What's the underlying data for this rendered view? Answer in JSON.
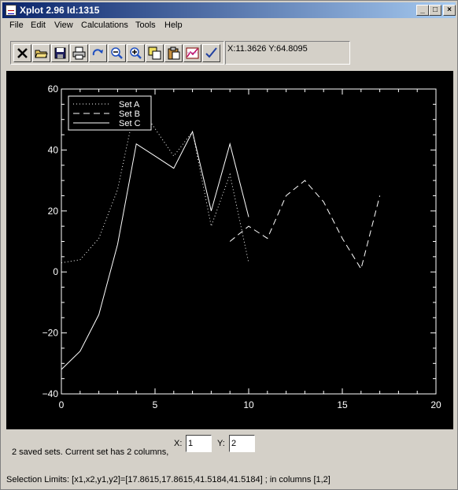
{
  "window": {
    "title": "Xplot 2.96 Id:1315",
    "min_symbol": "_",
    "max_symbol": "□",
    "close_symbol": "×"
  },
  "menu": [
    "File",
    "Edit",
    "View",
    "Calculations",
    "Tools",
    "Help"
  ],
  "toolbar": {
    "icons": [
      "close-x-icon",
      "open-folder-icon",
      "save-disk-icon",
      "print-icon",
      "redo-icon",
      "zoom-out-icon",
      "zoom-in-icon",
      "copy-icon",
      "clipboard-icon",
      "chart-icon",
      "checkmark-icon"
    ]
  },
  "coords": {
    "text": "X:11.3626 Y:64.8095"
  },
  "status": {
    "saved_sets": "2  saved sets. Current set has  2  columns,",
    "x_label": "X:",
    "x_value": "1",
    "y_label": "Y:",
    "y_value": "2",
    "selection": "Selection Limits: [x1,x2,y1,y2]=[17.8615,17.8615,41.5184,41.5184] ; in columns [1,2]"
  },
  "colors": {
    "plot_bg": "#000000",
    "plot_fg": "#ffffff",
    "title_bar_start": "#0a246a",
    "title_bar_end": "#a6caf0"
  },
  "chart_data": {
    "type": "line",
    "xlim": [
      0,
      20
    ],
    "ylim": [
      -40,
      60
    ],
    "xticks": [
      0,
      5,
      10,
      15,
      20
    ],
    "yticks": [
      -40,
      -20,
      0,
      20,
      40,
      60
    ],
    "legend_position": "top-left",
    "grid": false,
    "series": [
      {
        "name": "Set  A",
        "style": "dotted",
        "x": [
          0,
          1,
          2,
          3,
          4,
          5,
          6,
          7,
          8,
          9,
          10
        ],
        "y": [
          3,
          4,
          11,
          27,
          56,
          47,
          38,
          46,
          15,
          32,
          3
        ]
      },
      {
        "name": "Set  B",
        "style": "dashed",
        "x": [
          9,
          10,
          11,
          12,
          13,
          14,
          15,
          16,
          17
        ],
        "y": [
          10,
          15,
          11,
          25,
          30,
          23,
          11,
          1,
          25
        ]
      },
      {
        "name": "Set  C",
        "style": "solid",
        "x": [
          0,
          1,
          2,
          3,
          4,
          5,
          6,
          7,
          8,
          9,
          10
        ],
        "y": [
          -32,
          -26,
          -14,
          9,
          42,
          38,
          34,
          46,
          20,
          42,
          18
        ]
      }
    ]
  }
}
